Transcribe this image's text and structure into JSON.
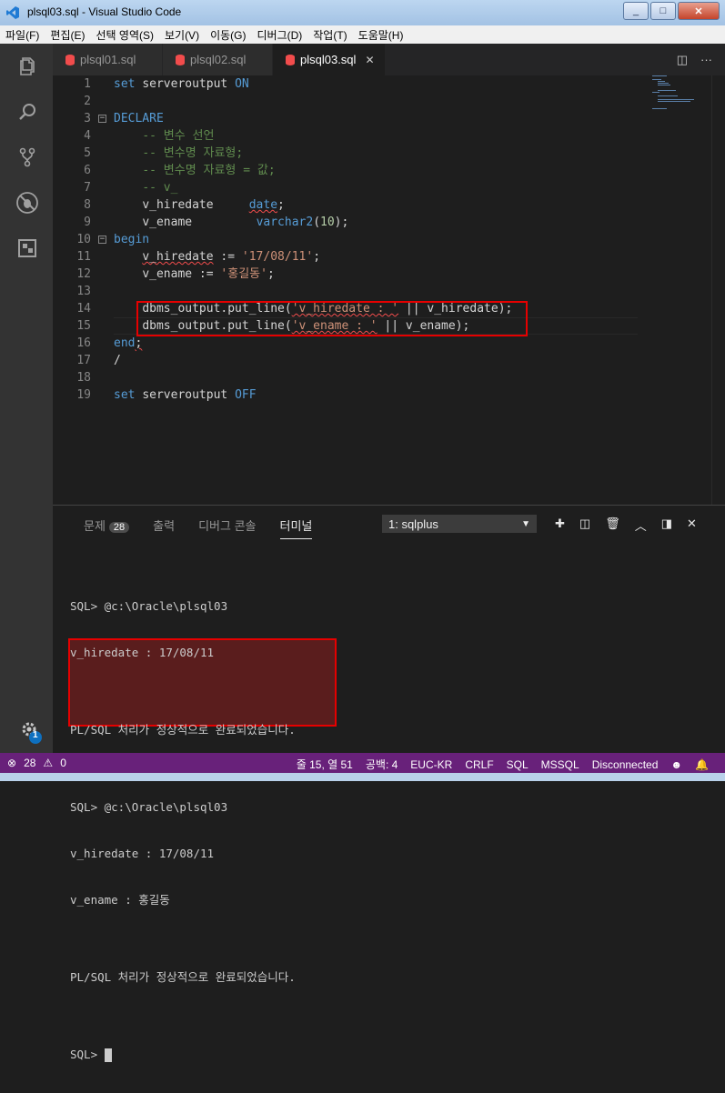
{
  "window": {
    "title": "plsql03.sql - Visual Studio Code",
    "minimize": "_",
    "maximize": "□",
    "close": "✕"
  },
  "menu": [
    "파일(F)",
    "편집(E)",
    "선택 영역(S)",
    "보기(V)",
    "이동(G)",
    "디버그(D)",
    "작업(T)",
    "도움말(H)"
  ],
  "tabs": [
    {
      "label": "plsql01.sql",
      "active": false
    },
    {
      "label": "plsql02.sql",
      "active": false
    },
    {
      "label": "plsql03.sql",
      "active": true
    }
  ],
  "editor": {
    "line_numbers": [
      "1",
      "2",
      "3",
      "4",
      "5",
      "6",
      "7",
      "8",
      "9",
      "10",
      "11",
      "12",
      "13",
      "14",
      "15",
      "16",
      "17",
      "18",
      "19"
    ],
    "lines": [
      "set serveroutput ON",
      "",
      "DECLARE",
      "    -- 변수 선언",
      "    -- 변수명 자료형;",
      "    -- 변수명 자료형 = 값;",
      "    -- v_",
      "    v_hiredate     date;",
      "    v_ename         varchar2(10);",
      "begin",
      "    v_hiredate := '17/08/11';",
      "    v_ename := '홍길동';",
      "",
      "    dbms_output.put_line('v_hiredate : ' || v_hiredate);",
      "    dbms_output.put_line('v_ename : ' || v_ename);",
      "end;",
      "/",
      "",
      "set serveroutput OFF"
    ],
    "tokens": {
      "set": "set",
      "serveroutput": "serveroutput",
      "on": "ON",
      "off": "OFF",
      "declare": "DECLARE",
      "begin": "begin",
      "end": "end",
      "semi": ";",
      "slash": "/",
      "c1": "-- 변수 선언",
      "c2": "-- 변수명 자료형;",
      "c3": "-- 변수명 자료형 = 값;",
      "c4": "-- v_",
      "v_hiredate": "v_hiredate",
      "v_ename": "v_ename",
      "date": "date",
      "varchar2": "varchar2",
      "lp": "(",
      "ten": "10",
      "rp": ");",
      "assign": " := ",
      "hiredate_val": "'17/08/11'",
      "ename_val": "'홍길동'",
      "put_line": "dbms_output.put_line(",
      "str1": "'v_hiredate : '",
      "str2": "'v_ename : '",
      "concat": " || ",
      "close": ");"
    }
  },
  "panel": {
    "tabs": {
      "problems": "문제",
      "problems_count": "28",
      "output": "출력",
      "debug_console": "디버그 콘솔",
      "terminal": "터미널"
    },
    "terminal_select": "1: sqlplus",
    "terminal_lines": [
      "SQL> @c:\\Oracle\\plsql03",
      "v_hiredate : 17/08/11",
      "",
      "PL/SQL 처리가 정상적으로 완료되었습니다.",
      "",
      "SQL> @c:\\Oracle\\plsql03",
      "v_hiredate : 17/08/11",
      "v_ename : 홍길동",
      "",
      "PL/SQL 처리가 정상적으로 완료되었습니다.",
      "",
      "SQL> "
    ]
  },
  "activity": {
    "settings_badge": "1"
  },
  "status": {
    "errors": "28",
    "warnings": "0",
    "position": "줄 15, 열 51",
    "spaces": "공백: 4",
    "encoding": "EUC-KR",
    "eol": "CRLF",
    "language": "SQL",
    "dialect": "MSSQL",
    "connection": "Disconnected"
  },
  "colors": {
    "status_bar": "#68217a",
    "highlight_border": "#e60000",
    "keyword": "#569cd6",
    "comment": "#608b4e",
    "string": "#ce9178"
  }
}
